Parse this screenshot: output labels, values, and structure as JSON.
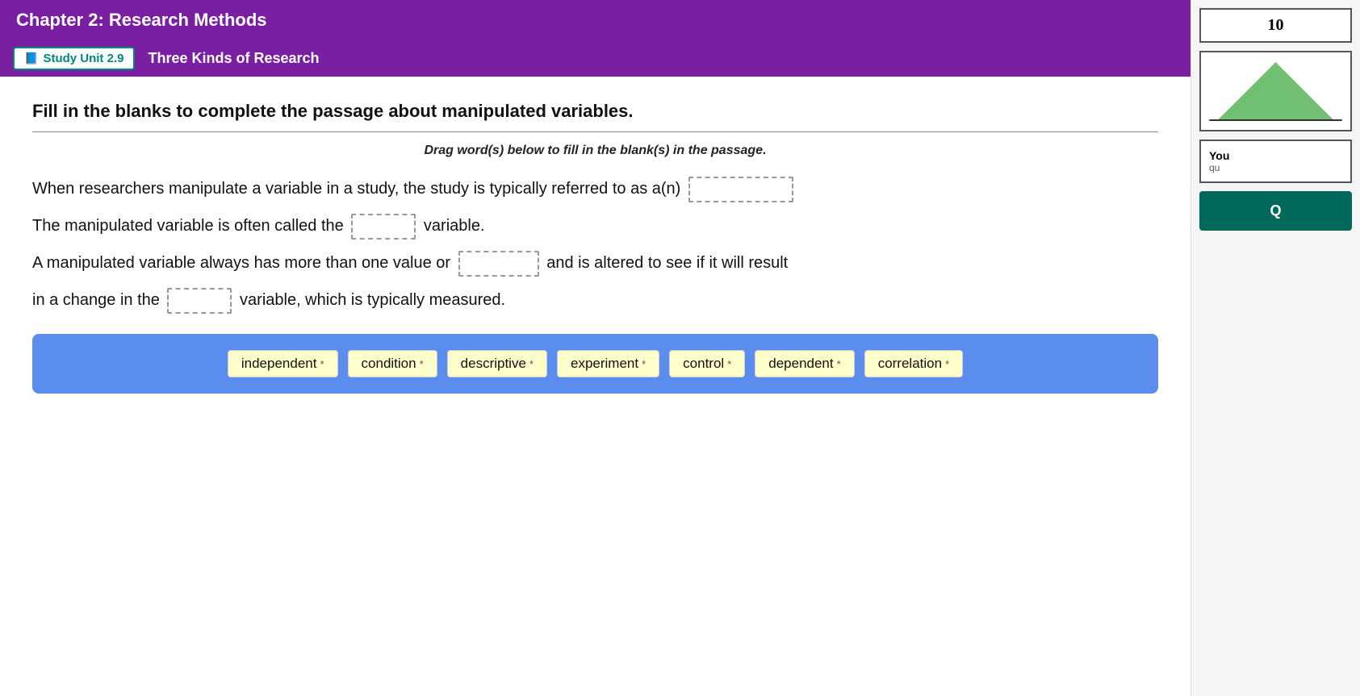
{
  "header": {
    "chapter_title": "Chapter 2: Research Methods"
  },
  "study_unit": {
    "badge_label": "Study Unit 2.9",
    "title": "Three Kinds of Research",
    "page_number": "10"
  },
  "content": {
    "instruction": "Fill in the blanks to complete the passage about manipulated variables.",
    "drag_instruction": "Drag word(s) below to fill in the blank(s) in the passage.",
    "paragraph1": "When researchers manipulate a variable in a study, the study is typically referred to as a(n)",
    "paragraph2": "The manipulated variable is often called the",
    "paragraph2_end": "variable.",
    "paragraph3": "A manipulated variable always has more than one value or",
    "paragraph3_mid": "and is altered to see if it will result",
    "paragraph4": "in a change in the",
    "paragraph4_end": "variable, which is typically measured."
  },
  "word_bank": {
    "words": [
      {
        "label": "independent",
        "asterisk": "*"
      },
      {
        "label": "condition",
        "asterisk": "*"
      },
      {
        "label": "descriptive",
        "asterisk": "*"
      },
      {
        "label": "experiment",
        "asterisk": "*"
      },
      {
        "label": "control",
        "asterisk": "*"
      },
      {
        "label": "dependent",
        "asterisk": "*"
      },
      {
        "label": "correlation",
        "asterisk": "*"
      }
    ]
  },
  "sidebar": {
    "you_label": "You",
    "you_subtext": "qu",
    "q_button_label": "Q"
  }
}
